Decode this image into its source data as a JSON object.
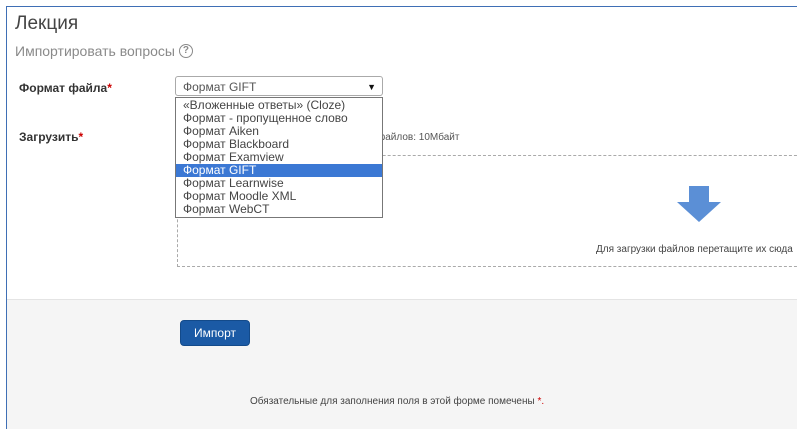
{
  "page": {
    "title": "Лекция",
    "subtitle": "Импортировать вопросы",
    "help_icon": "?"
  },
  "form": {
    "file_format_label": "Формат файла",
    "required_mark": "*",
    "selected_format": "Формат GIFT",
    "dropdown_arrow": "▼",
    "format_options": [
      "«Вложенные ответы» (Cloze)",
      "Формат - пропущенное слово",
      "Формат Aiken",
      "Формат Blackboard",
      "Формат Examview",
      "Формат GIFT",
      "Формат Learnwise",
      "Формат Moodle XML",
      "Формат WebCT"
    ],
    "selected_index": 5,
    "upload_label": "Загрузить",
    "max_size_text": "мер для новых файлов: 10Мбайт",
    "drop_text": "Для загрузки файлов перетащите их сюда",
    "import_button": "Импорт",
    "required_note": "Обязательные для заполнения поля в этой форме помечены",
    "required_note_mark": "*."
  },
  "colors": {
    "accent": "#1b5aa5",
    "selection": "#3b78d4",
    "required": "#cc0000",
    "drop_arrow": "#5b8fd6"
  },
  "icons": {
    "help": "help-icon",
    "drop": "down-arrow-icon"
  }
}
